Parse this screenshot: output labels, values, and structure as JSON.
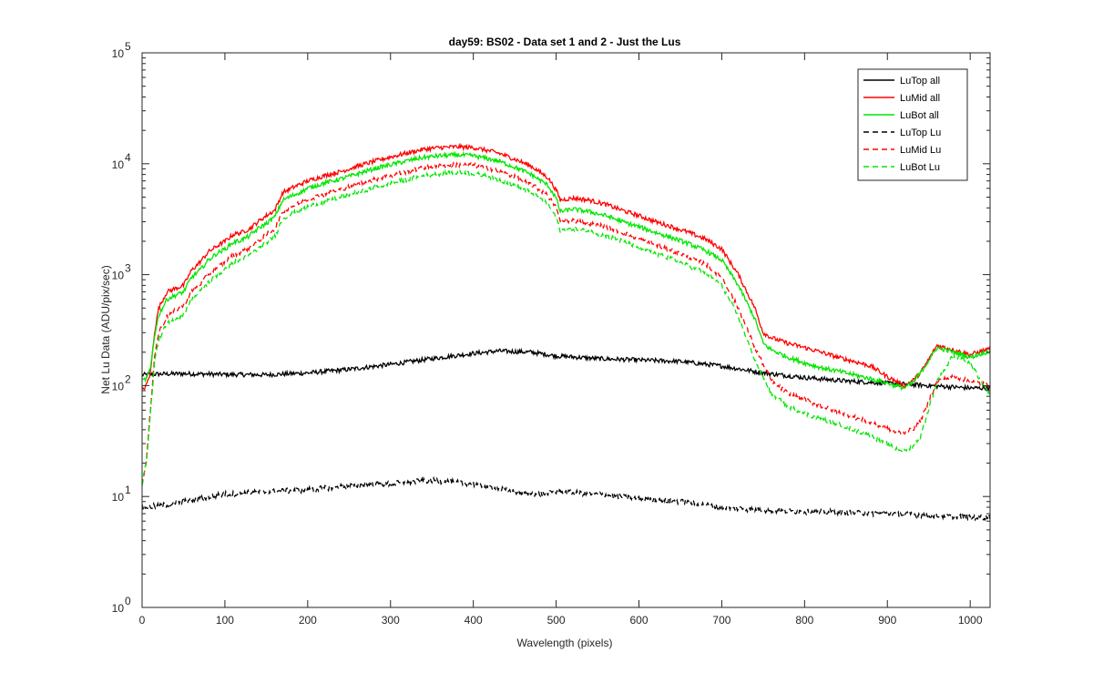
{
  "chart_data": {
    "type": "line",
    "title": "day59: BS02 - Data set 1 and 2 - Just the Lus",
    "xlabel": "Wavelength (pixels)",
    "ylabel": "Net Lu Data (ADU/pix/sec)",
    "xlim": [
      0,
      1024
    ],
    "ylim": [
      1,
      100000
    ],
    "yscale": "log",
    "xticks": [
      "0",
      "100",
      "200",
      "300",
      "400",
      "500",
      "600",
      "700",
      "800",
      "900",
      "1000"
    ],
    "ytick_base": "10",
    "ytick_exponents": [
      "0",
      "1",
      "2",
      "3",
      "4",
      "5"
    ],
    "legend_position": "top-right",
    "grid": false,
    "series": [
      {
        "name": "LuTop  all",
        "color": "#000000",
        "dash": "solid",
        "x": [
          0,
          20,
          50,
          100,
          150,
          200,
          250,
          300,
          350,
          400,
          430,
          470,
          500,
          550,
          600,
          650,
          700,
          750,
          800,
          850,
          900,
          950,
          1000,
          1024
        ],
        "y": [
          125,
          127,
          128,
          126,
          125,
          130,
          140,
          155,
          175,
          195,
          205,
          200,
          185,
          175,
          170,
          165,
          150,
          130,
          118,
          110,
          105,
          100,
          95,
          95
        ]
      },
      {
        "name": "LuMid  all",
        "color": "#ff0000",
        "dash": "solid",
        "x": [
          0,
          5,
          10,
          15,
          20,
          30,
          40,
          50,
          60,
          70,
          80,
          90,
          100,
          110,
          120,
          130,
          140,
          150,
          160,
          170,
          180,
          190,
          200,
          220,
          240,
          260,
          280,
          300,
          320,
          340,
          360,
          380,
          400,
          410,
          420,
          430,
          450,
          470,
          490,
          500,
          505,
          520,
          540,
          560,
          580,
          600,
          620,
          640,
          660,
          680,
          700,
          720,
          740,
          750,
          760,
          780,
          800,
          820,
          840,
          860,
          880,
          900,
          910,
          920,
          930,
          940,
          960,
          980,
          1000,
          1024
        ],
        "y": [
          90,
          100,
          130,
          300,
          500,
          700,
          750,
          800,
          1100,
          1300,
          1600,
          1800,
          2000,
          2300,
          2400,
          2600,
          3000,
          3400,
          3800,
          5500,
          6000,
          6500,
          7000,
          7800,
          8500,
          9500,
          10500,
          11500,
          12500,
          13500,
          14000,
          14200,
          14000,
          13500,
          13000,
          12500,
          11000,
          9500,
          7500,
          5800,
          4700,
          4900,
          4700,
          4300,
          3800,
          3400,
          3000,
          2700,
          2400,
          2100,
          1700,
          1000,
          500,
          300,
          270,
          240,
          220,
          200,
          180,
          165,
          150,
          120,
          110,
          100,
          110,
          130,
          230,
          210,
          190,
          215
        ]
      },
      {
        "name": "LuBot  all",
        "color": "#00e600",
        "dash": "solid",
        "x": [
          0,
          5,
          10,
          15,
          20,
          30,
          40,
          50,
          60,
          70,
          80,
          90,
          100,
          110,
          120,
          130,
          140,
          150,
          160,
          170,
          180,
          190,
          200,
          220,
          240,
          260,
          280,
          300,
          320,
          340,
          360,
          380,
          400,
          410,
          420,
          430,
          450,
          470,
          490,
          500,
          505,
          520,
          540,
          560,
          580,
          600,
          620,
          640,
          660,
          680,
          700,
          720,
          740,
          750,
          760,
          780,
          800,
          820,
          840,
          860,
          880,
          900,
          910,
          920,
          930,
          940,
          960,
          980,
          1000,
          1024
        ],
        "y": [
          110,
          115,
          140,
          280,
          430,
          600,
          650,
          700,
          950,
          1100,
          1350,
          1550,
          1700,
          1950,
          2050,
          2250,
          2600,
          2900,
          3300,
          4700,
          5100,
          5500,
          6000,
          6700,
          7300,
          8100,
          9000,
          9800,
          10600,
          11400,
          11800,
          12000,
          11800,
          11400,
          11000,
          10600,
          9300,
          8000,
          6400,
          4900,
          3700,
          3900,
          3700,
          3400,
          3000,
          2700,
          2400,
          2150,
          1900,
          1650,
          1350,
          800,
          400,
          240,
          210,
          180,
          160,
          145,
          135,
          125,
          115,
          105,
          100,
          95,
          105,
          130,
          220,
          200,
          180,
          205
        ]
      },
      {
        "name": "LuTop  Lu",
        "color": "#000000",
        "dash": "dashed",
        "x": [
          0,
          20,
          50,
          100,
          150,
          200,
          250,
          300,
          350,
          400,
          450,
          480,
          500,
          550,
          600,
          650,
          700,
          750,
          800,
          850,
          900,
          950,
          1000,
          1024
        ],
        "y": [
          8,
          8.2,
          9,
          10.5,
          11,
          11.5,
          12.5,
          13,
          14,
          13,
          11,
          10.5,
          11,
          10.5,
          9.5,
          9,
          8,
          7.5,
          7.3,
          7.2,
          7,
          6.8,
          6.5,
          6.5
        ]
      },
      {
        "name": "LuMid  Lu",
        "color": "#ff0000",
        "dash": "dashed",
        "x": [
          0,
          5,
          10,
          15,
          20,
          30,
          40,
          50,
          60,
          70,
          80,
          90,
          100,
          110,
          120,
          130,
          140,
          150,
          160,
          170,
          180,
          190,
          200,
          220,
          240,
          260,
          280,
          300,
          320,
          340,
          360,
          380,
          400,
          410,
          420,
          430,
          450,
          470,
          490,
          500,
          505,
          520,
          540,
          560,
          580,
          600,
          620,
          640,
          660,
          680,
          700,
          720,
          740,
          760,
          780,
          800,
          820,
          840,
          860,
          880,
          900,
          910,
          920,
          930,
          940,
          960,
          980,
          1000,
          1024
        ],
        "y": [
          13,
          20,
          60,
          180,
          300,
          420,
          480,
          520,
          700,
          820,
          1000,
          1150,
          1300,
          1500,
          1600,
          1750,
          2000,
          2300,
          2600,
          3700,
          4100,
          4400,
          4800,
          5300,
          5900,
          6500,
          7200,
          7800,
          8500,
          9200,
          9600,
          9800,
          9700,
          9400,
          9000,
          8600,
          7600,
          6500,
          5200,
          4000,
          3000,
          3100,
          2900,
          2700,
          2400,
          2100,
          1850,
          1650,
          1450,
          1250,
          950,
          500,
          220,
          110,
          85,
          75,
          65,
          58,
          52,
          46,
          41,
          38,
          38,
          40,
          48,
          110,
          120,
          110,
          100
        ]
      },
      {
        "name": "LuBot  Lu",
        "color": "#00e600",
        "dash": "dashed",
        "x": [
          0,
          5,
          10,
          15,
          20,
          30,
          40,
          50,
          60,
          70,
          80,
          90,
          100,
          110,
          120,
          130,
          140,
          150,
          160,
          170,
          180,
          190,
          200,
          220,
          240,
          260,
          280,
          300,
          320,
          340,
          360,
          380,
          400,
          410,
          420,
          430,
          450,
          470,
          490,
          500,
          505,
          520,
          540,
          560,
          580,
          600,
          620,
          640,
          660,
          680,
          700,
          720,
          740,
          760,
          780,
          800,
          820,
          840,
          860,
          880,
          900,
          910,
          920,
          930,
          940,
          960,
          980,
          1000,
          1024
        ],
        "y": [
          13,
          20,
          55,
          160,
          260,
          360,
          400,
          440,
          600,
          700,
          850,
          980,
          1100,
          1280,
          1370,
          1500,
          1700,
          1950,
          2200,
          3200,
          3500,
          3800,
          4100,
          4500,
          5000,
          5500,
          6100,
          6600,
          7200,
          7800,
          8100,
          8300,
          8200,
          7900,
          7600,
          7200,
          6400,
          5500,
          4300,
          3300,
          2500,
          2600,
          2450,
          2250,
          2000,
          1750,
          1550,
          1380,
          1200,
          1050,
          800,
          420,
          170,
          85,
          65,
          56,
          50,
          45,
          40,
          35,
          30,
          27,
          26,
          28,
          35,
          110,
          190,
          160,
          80
        ]
      }
    ]
  }
}
